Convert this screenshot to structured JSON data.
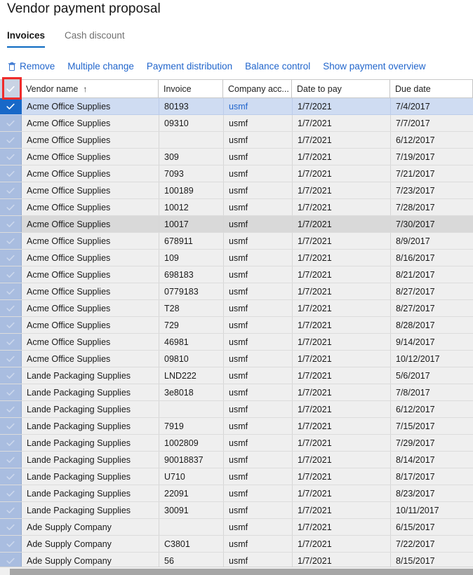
{
  "page": {
    "title": "Vendor payment proposal"
  },
  "tabs": [
    {
      "label": "Invoices",
      "active": true
    },
    {
      "label": "Cash discount",
      "active": false
    }
  ],
  "commandbar": {
    "items": [
      {
        "label": "Remove",
        "icon": "trash-icon"
      },
      {
        "label": "Multiple change",
        "icon": ""
      },
      {
        "label": "Payment distribution",
        "icon": ""
      },
      {
        "label": "Balance control",
        "icon": ""
      },
      {
        "label": "Show payment overview",
        "icon": ""
      }
    ]
  },
  "grid": {
    "select_all_checked": true,
    "sort_indicator": "↑",
    "columns": [
      {
        "key": "select",
        "label": ""
      },
      {
        "key": "vendor_name",
        "label": "Vendor name",
        "sorted": "asc"
      },
      {
        "key": "invoice",
        "label": "Invoice"
      },
      {
        "key": "company_account",
        "label": "Company acc..."
      },
      {
        "key": "date_to_pay",
        "label": "Date to pay"
      },
      {
        "key": "due_date",
        "label": "Due date"
      }
    ],
    "rows": [
      {
        "checked": true,
        "vendor_name": "Acme Office Supplies",
        "invoice": "80193",
        "company_account": "usmf",
        "date_to_pay": "1/7/2021",
        "due_date": "7/4/2017",
        "state": "selected"
      },
      {
        "checked": true,
        "vendor_name": "Acme Office Supplies",
        "invoice": "09310",
        "company_account": "usmf",
        "date_to_pay": "1/7/2021",
        "due_date": "7/7/2017",
        "state": "normal"
      },
      {
        "checked": true,
        "vendor_name": "Acme Office Supplies",
        "invoice": "",
        "company_account": "usmf",
        "date_to_pay": "1/7/2021",
        "due_date": "6/12/2017",
        "state": "normal"
      },
      {
        "checked": true,
        "vendor_name": "Acme Office Supplies",
        "invoice": "309",
        "company_account": "usmf",
        "date_to_pay": "1/7/2021",
        "due_date": "7/19/2017",
        "state": "normal"
      },
      {
        "checked": true,
        "vendor_name": "Acme Office Supplies",
        "invoice": "7093",
        "company_account": "usmf",
        "date_to_pay": "1/7/2021",
        "due_date": "7/21/2017",
        "state": "normal"
      },
      {
        "checked": true,
        "vendor_name": "Acme Office Supplies",
        "invoice": "100189",
        "company_account": "usmf",
        "date_to_pay": "1/7/2021",
        "due_date": "7/23/2017",
        "state": "normal"
      },
      {
        "checked": true,
        "vendor_name": "Acme Office Supplies",
        "invoice": "10012",
        "company_account": "usmf",
        "date_to_pay": "1/7/2021",
        "due_date": "7/28/2017",
        "state": "normal"
      },
      {
        "checked": true,
        "vendor_name": "Acme Office Supplies",
        "invoice": "10017",
        "company_account": "usmf",
        "date_to_pay": "1/7/2021",
        "due_date": "7/30/2017",
        "state": "hover"
      },
      {
        "checked": true,
        "vendor_name": "Acme Office Supplies",
        "invoice": "678911",
        "company_account": "usmf",
        "date_to_pay": "1/7/2021",
        "due_date": "8/9/2017",
        "state": "normal"
      },
      {
        "checked": true,
        "vendor_name": "Acme Office Supplies",
        "invoice": "109",
        "company_account": "usmf",
        "date_to_pay": "1/7/2021",
        "due_date": "8/16/2017",
        "state": "normal"
      },
      {
        "checked": true,
        "vendor_name": "Acme Office Supplies",
        "invoice": "698183",
        "company_account": "usmf",
        "date_to_pay": "1/7/2021",
        "due_date": "8/21/2017",
        "state": "normal"
      },
      {
        "checked": true,
        "vendor_name": "Acme Office Supplies",
        "invoice": "0779183",
        "company_account": "usmf",
        "date_to_pay": "1/7/2021",
        "due_date": "8/27/2017",
        "state": "normal"
      },
      {
        "checked": true,
        "vendor_name": "Acme Office Supplies",
        "invoice": "T28",
        "company_account": "usmf",
        "date_to_pay": "1/7/2021",
        "due_date": "8/27/2017",
        "state": "normal"
      },
      {
        "checked": true,
        "vendor_name": "Acme Office Supplies",
        "invoice": "729",
        "company_account": "usmf",
        "date_to_pay": "1/7/2021",
        "due_date": "8/28/2017",
        "state": "normal"
      },
      {
        "checked": true,
        "vendor_name": "Acme Office Supplies",
        "invoice": "46981",
        "company_account": "usmf",
        "date_to_pay": "1/7/2021",
        "due_date": "9/14/2017",
        "state": "normal"
      },
      {
        "checked": true,
        "vendor_name": "Acme Office Supplies",
        "invoice": "09810",
        "company_account": "usmf",
        "date_to_pay": "1/7/2021",
        "due_date": "10/12/2017",
        "state": "normal"
      },
      {
        "checked": true,
        "vendor_name": "Lande Packaging Supplies",
        "invoice": "LND222",
        "company_account": "usmf",
        "date_to_pay": "1/7/2021",
        "due_date": "5/6/2017",
        "state": "normal"
      },
      {
        "checked": true,
        "vendor_name": "Lande Packaging Supplies",
        "invoice": "3e8018",
        "company_account": "usmf",
        "date_to_pay": "1/7/2021",
        "due_date": "7/8/2017",
        "state": "normal"
      },
      {
        "checked": true,
        "vendor_name": "Lande Packaging Supplies",
        "invoice": "",
        "company_account": "usmf",
        "date_to_pay": "1/7/2021",
        "due_date": "6/12/2017",
        "state": "normal"
      },
      {
        "checked": true,
        "vendor_name": "Lande Packaging Supplies",
        "invoice": "7919",
        "company_account": "usmf",
        "date_to_pay": "1/7/2021",
        "due_date": "7/15/2017",
        "state": "normal"
      },
      {
        "checked": true,
        "vendor_name": "Lande Packaging Supplies",
        "invoice": "1002809",
        "company_account": "usmf",
        "date_to_pay": "1/7/2021",
        "due_date": "7/29/2017",
        "state": "normal"
      },
      {
        "checked": true,
        "vendor_name": "Lande Packaging Supplies",
        "invoice": "90018837",
        "company_account": "usmf",
        "date_to_pay": "1/7/2021",
        "due_date": "8/14/2017",
        "state": "normal"
      },
      {
        "checked": true,
        "vendor_name": "Lande Packaging Supplies",
        "invoice": "U710",
        "company_account": "usmf",
        "date_to_pay": "1/7/2021",
        "due_date": "8/17/2017",
        "state": "normal"
      },
      {
        "checked": true,
        "vendor_name": "Lande Packaging Supplies",
        "invoice": "22091",
        "company_account": "usmf",
        "date_to_pay": "1/7/2021",
        "due_date": "8/23/2017",
        "state": "normal"
      },
      {
        "checked": true,
        "vendor_name": "Lande Packaging Supplies",
        "invoice": "30091",
        "company_account": "usmf",
        "date_to_pay": "1/7/2021",
        "due_date": "10/11/2017",
        "state": "normal"
      },
      {
        "checked": true,
        "vendor_name": "Ade Supply Company",
        "invoice": "",
        "company_account": "usmf",
        "date_to_pay": "1/7/2021",
        "due_date": "6/15/2017",
        "state": "normal"
      },
      {
        "checked": true,
        "vendor_name": "Ade Supply Company",
        "invoice": "C3801",
        "company_account": "usmf",
        "date_to_pay": "1/7/2021",
        "due_date": "7/22/2017",
        "state": "normal"
      },
      {
        "checked": true,
        "vendor_name": "Ade Supply Company",
        "invoice": "56",
        "company_account": "usmf",
        "date_to_pay": "1/7/2021",
        "due_date": "8/15/2017",
        "state": "normal"
      }
    ]
  },
  "colors": {
    "accent": "#2266cc",
    "tab_underline": "#0a68c1",
    "row_selected": "#cfdcf2",
    "row_base": "#efefef",
    "row_hover": "#d9d9d9",
    "checkbox_on": "#1868c8",
    "checkbox_col": "#a9bde0",
    "annotation": "#ef2b2b"
  }
}
